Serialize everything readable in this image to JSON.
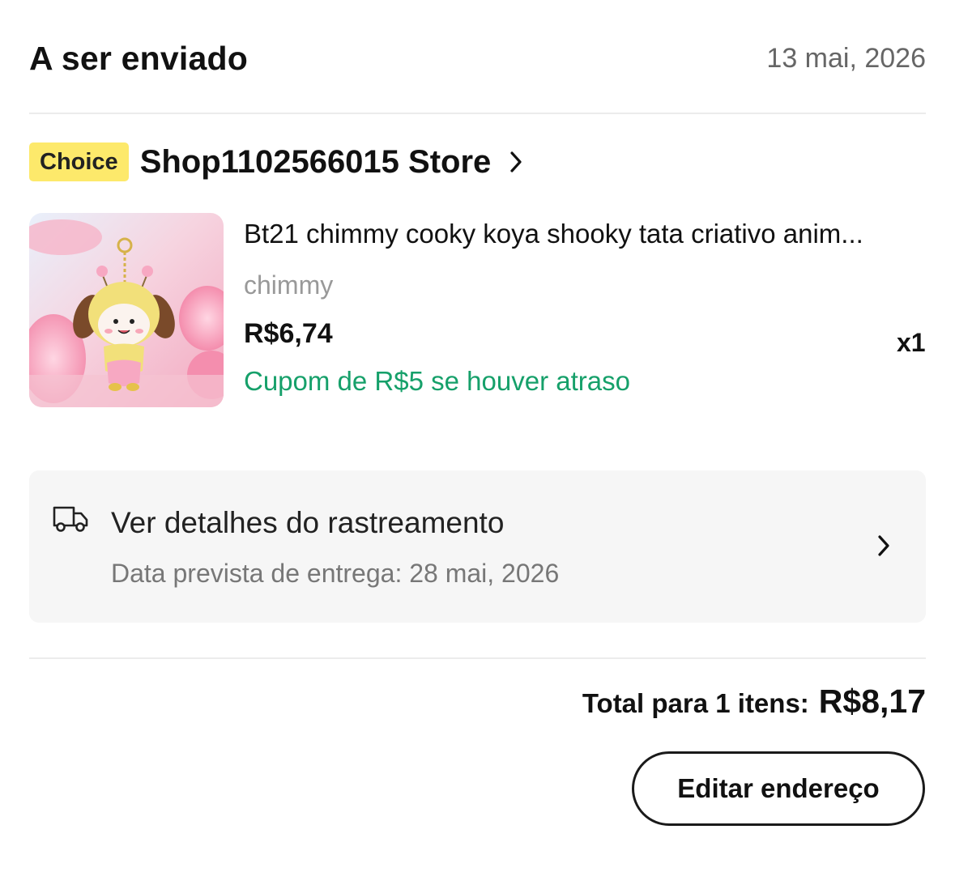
{
  "order": {
    "status": "A ser enviado",
    "date": "13 mai, 2026"
  },
  "store": {
    "badge": "Choice",
    "name": "Shop1102566015 Store",
    "chevron_icon": "chevron-right-icon"
  },
  "product": {
    "title": "Bt21 chimmy cooky koya shooky tata criativo anim...",
    "variant": "chimmy",
    "price": "R$6,74",
    "quantity": "x1",
    "coupon": "Cupom de R$5 se houver atraso",
    "image_icon": "chimmy-plush-keychain-image"
  },
  "tracking": {
    "icon": "delivery-truck-icon",
    "title": "Ver detalhes do rastreamento",
    "subtitle": "Data prevista de entrega: 28 mai, 2026"
  },
  "total": {
    "label": "Total para 1 itens:",
    "value": "R$8,17"
  },
  "actions": {
    "edit_address": "Editar endereço"
  },
  "colors": {
    "badge": "#fde96b",
    "coupon": "#16a06a",
    "tracking_bg": "#f6f6f6",
    "muted": "#999999"
  }
}
